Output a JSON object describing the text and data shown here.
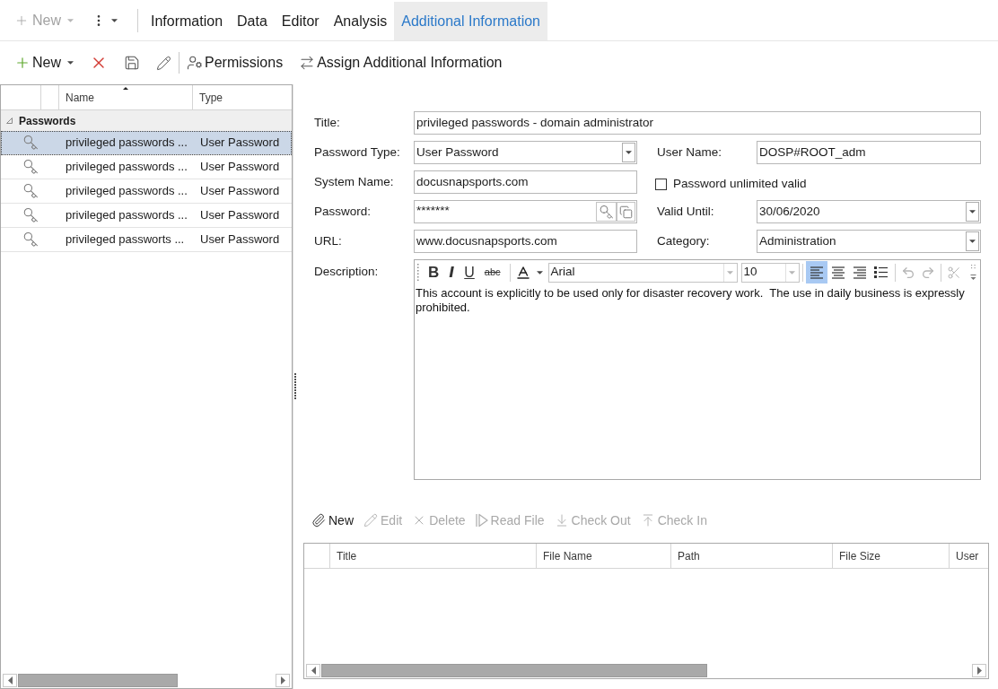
{
  "tab_bar": {
    "new_button": {
      "label": "New",
      "disabled": true
    },
    "tabs": [
      {
        "label": "Information",
        "selected": false
      },
      {
        "label": "Data",
        "selected": false
      },
      {
        "label": "Editor",
        "selected": false
      },
      {
        "label": "Analysis",
        "selected": false
      },
      {
        "label": "Additional Information",
        "selected": true
      }
    ]
  },
  "toolbar": {
    "groups": [
      {
        "items": [
          {
            "kind": "new",
            "label": "New",
            "disabled": false
          },
          {
            "kind": "delete",
            "disabled": false
          },
          {
            "kind": "save",
            "disabled": false
          },
          {
            "kind": "edit",
            "disabled": false
          }
        ]
      },
      {
        "items": [
          {
            "kind": "permissions",
            "label": "Permissions",
            "disabled": false
          },
          {
            "kind": "assign",
            "label": "Assign Additional Information",
            "disabled": false
          }
        ]
      }
    ]
  },
  "password_list": {
    "columns": [
      {
        "label": "Name",
        "sorted": true
      },
      {
        "label": "Type",
        "sorted": false
      }
    ],
    "groups": [
      {
        "label": "Passwords",
        "expanded": true,
        "rows": [
          {
            "name": "privileged passwords ...",
            "type": "User Password",
            "selected": true
          },
          {
            "name": "privileged passwords ...",
            "type": "User Password",
            "selected": false
          },
          {
            "name": "privileged passwords ...",
            "type": "User Password",
            "selected": false
          },
          {
            "name": "privileged passwords ...",
            "type": "User Password",
            "selected": false
          },
          {
            "name": "privileged passworts ...",
            "type": "User Password",
            "selected": false
          }
        ]
      }
    ]
  },
  "form": {
    "title": {
      "label": "Title:",
      "value": "privileged passwords - domain administrator"
    },
    "rows": [
      {
        "left": {
          "kind": "select",
          "label": "Password Type:",
          "value": "User Password"
        },
        "right": {
          "kind": "text",
          "label": "User Name:",
          "value": "DOSP#ROOT_adm"
        }
      },
      {
        "left": {
          "kind": "text",
          "label": "System Name:",
          "value": "docusnapsports.com"
        },
        "right": {
          "kind": "checkbox",
          "label": "Password unlimited valid",
          "checked": false
        }
      },
      {
        "left": {
          "kind": "password",
          "label": "Password:",
          "value": "*******"
        },
        "right": {
          "kind": "select",
          "label": "Valid Until:",
          "value": "30/06/2020"
        }
      },
      {
        "left": {
          "kind": "text",
          "label": "URL:",
          "value": "www.docusnapsports.com"
        },
        "right": {
          "kind": "select",
          "label": "Category:",
          "value": "Administration"
        }
      }
    ],
    "description": {
      "label": "Description:",
      "editor": {
        "format_buttons": [
          {
            "kind": "bold",
            "label": "B"
          },
          {
            "kind": "italic",
            "label": "I"
          },
          {
            "kind": "underline",
            "label": "U"
          },
          {
            "kind": "strikethrough",
            "label": "abc"
          }
        ],
        "font": "Arial",
        "size": "10",
        "paragraph_buttons": [
          {
            "kind": "align_left",
            "selected": true
          },
          {
            "kind": "align_center",
            "selected": false
          },
          {
            "kind": "align_right",
            "selected": false
          },
          {
            "kind": "bullets",
            "selected": false
          }
        ],
        "history_buttons": [
          {
            "kind": "undo",
            "disabled": true
          },
          {
            "kind": "redo",
            "disabled": true
          }
        ],
        "clipboard_buttons": [
          {
            "kind": "cut",
            "disabled": true
          }
        ],
        "text": "This account is explicitly to be used only for disaster recovery work.  The use in daily business is expressly prohibited."
      }
    }
  },
  "attachments": {
    "toolbar": [
      {
        "kind": "new",
        "label": "New",
        "disabled": false
      },
      {
        "kind": "edit",
        "label": "Edit",
        "disabled": true
      },
      {
        "kind": "delete",
        "label": "Delete",
        "disabled": true
      },
      {
        "kind": "read_file",
        "label": "Read File",
        "disabled": true
      },
      {
        "kind": "check_out",
        "label": "Check Out",
        "disabled": true
      },
      {
        "kind": "check_in",
        "label": "Check In",
        "disabled": true
      }
    ],
    "table": {
      "columns": [
        "Title",
        "File Name",
        "Path",
        "File Size",
        "User"
      ]
    }
  }
}
